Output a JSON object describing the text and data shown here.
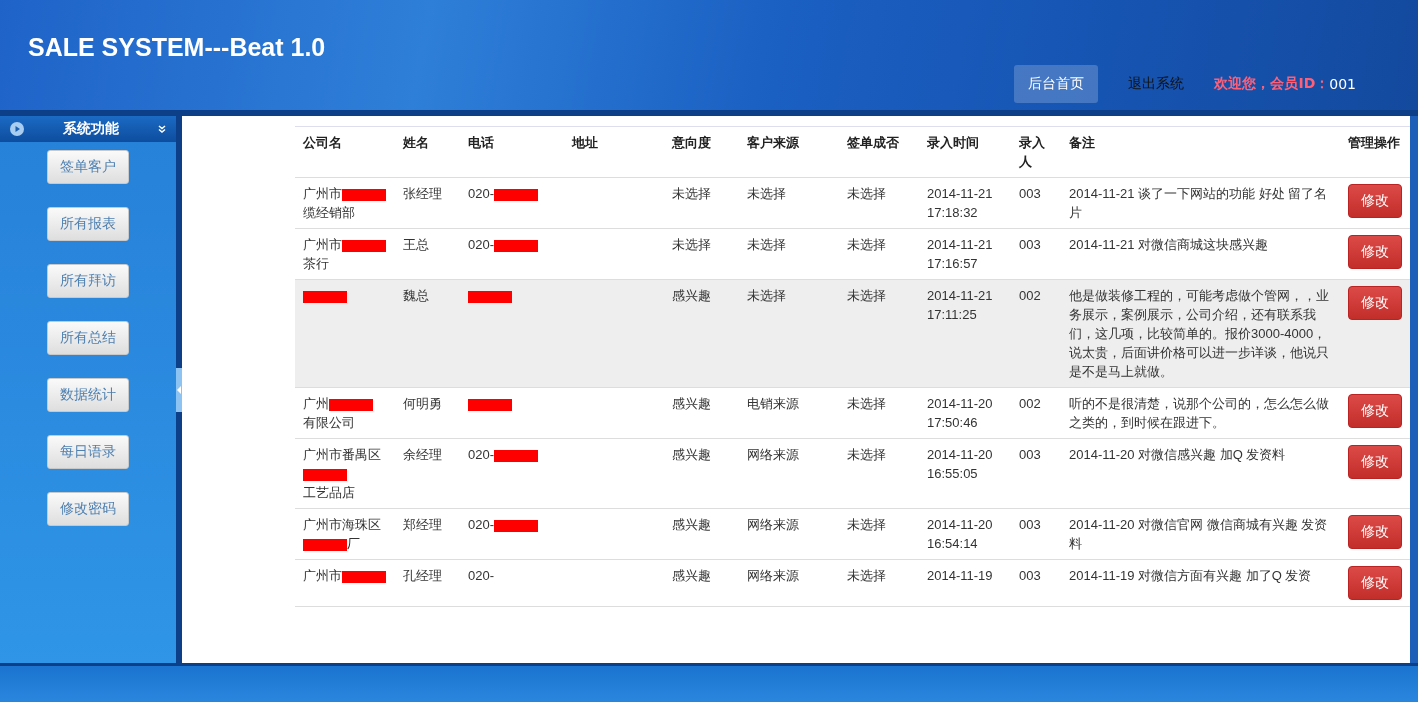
{
  "header": {
    "title": "SALE SYSTEM---Beat 1.0",
    "nav": [
      {
        "label": "后台首页",
        "selected": true
      },
      {
        "label": "退出系统",
        "selected": false
      }
    ],
    "welcome": "欢迎您，会员ID：",
    "member_id": "001"
  },
  "sidebar": {
    "title": "系统功能",
    "items": [
      "签单客户",
      "所有报表",
      "所有拜访",
      "所有总结",
      "数据统计",
      "每日语录",
      "修改密码"
    ]
  },
  "table": {
    "columns": [
      "公司名",
      "姓名",
      "电话",
      "地址",
      "意向度",
      "客户来源",
      "签单成否",
      "录入时间",
      "录入人",
      "备注",
      "管理操作"
    ],
    "rows": [
      {
        "highlighted": false,
        "company": [
          {
            "kind": "text",
            "text": "广州市"
          },
          {
            "kind": "redacted"
          },
          {
            "kind": "text",
            "text": "缆经销部"
          }
        ],
        "name": "张经理",
        "phone": [
          {
            "kind": "text",
            "text": "020-"
          },
          {
            "kind": "redacted"
          }
        ],
        "intent": "未选择",
        "source": "未选择",
        "signed": "未选择",
        "time": "2014-11-21 17:18:32",
        "entered_by": "003",
        "remark": "2014-11-21 谈了一下网站的功能 好处 留了名片",
        "action": "修改"
      },
      {
        "highlighted": false,
        "company": [
          {
            "kind": "text",
            "text": "广州市"
          },
          {
            "kind": "redacted"
          },
          {
            "kind": "text",
            "text": "茶行"
          }
        ],
        "name": "王总",
        "phone": [
          {
            "kind": "text",
            "text": "020-"
          },
          {
            "kind": "redacted"
          }
        ],
        "intent": "未选择",
        "source": "未选择",
        "signed": "未选择",
        "time": "2014-11-21 17:16:57",
        "entered_by": "003",
        "remark": "2014-11-21 对微信商城这块感兴趣",
        "action": "修改"
      },
      {
        "highlighted": true,
        "company": [
          {
            "kind": "redacted"
          }
        ],
        "name": "魏总",
        "phone": [
          {
            "kind": "redacted"
          }
        ],
        "intent": "感兴趣",
        "source": "未选择",
        "signed": "未选择",
        "time": "2014-11-21 17:11:25",
        "entered_by": "002",
        "remark": "他是做装修工程的，可能考虑做个管网，，业务展示，案例展示，公司介绍，还有联系我们，这几项，比较简单的。报价3000-4000，说太贵，后面讲价格可以进一步详谈，他说只是不是马上就做。",
        "action": "修改"
      },
      {
        "highlighted": false,
        "company": [
          {
            "kind": "text",
            "text": "广州"
          },
          {
            "kind": "redacted"
          },
          {
            "kind": "text",
            "text": "有限公司"
          }
        ],
        "name": "何明勇",
        "phone": [
          {
            "kind": "redacted"
          }
        ],
        "intent": "感兴趣",
        "source": "电销来源",
        "signed": "未选择",
        "time": "2014-11-20 17:50:46",
        "entered_by": "002",
        "remark": "听的不是很清楚，说那个公司的，怎么怎么做之类的，到时候在跟进下。",
        "action": "修改"
      },
      {
        "highlighted": false,
        "company": [
          {
            "kind": "text",
            "text": "广州市番禺区"
          },
          {
            "kind": "redacted"
          },
          {
            "kind": "text",
            "text": "工艺品店"
          }
        ],
        "name": "余经理",
        "phone": [
          {
            "kind": "text",
            "text": "020-"
          },
          {
            "kind": "redacted"
          }
        ],
        "intent": "感兴趣",
        "source": "网络来源",
        "signed": "未选择",
        "time": "2014-11-20 16:55:05",
        "entered_by": "003",
        "remark": "2014-11-20 对微信感兴趣 加Q 发资料",
        "action": "修改"
      },
      {
        "highlighted": false,
        "company": [
          {
            "kind": "text",
            "text": "广州市海珠区"
          },
          {
            "kind": "redacted"
          },
          {
            "kind": "text",
            "text": "厂"
          }
        ],
        "name": "郑经理",
        "phone": [
          {
            "kind": "text",
            "text": "020-"
          },
          {
            "kind": "redacted"
          }
        ],
        "intent": "感兴趣",
        "source": "网络来源",
        "signed": "未选择",
        "time": "2014-11-20 16:54:14",
        "entered_by": "003",
        "remark": "2014-11-20 对微信官网 微信商城有兴趣 发资料",
        "action": "修改"
      },
      {
        "highlighted": false,
        "company": [
          {
            "kind": "text",
            "text": "广州市"
          },
          {
            "kind": "redacted"
          }
        ],
        "name": "孔经理",
        "phone": [
          {
            "kind": "text",
            "text": "020-"
          }
        ],
        "intent": "感兴趣",
        "source": "网络来源",
        "signed": "未选择",
        "time": "2014-11-19",
        "entered_by": "003",
        "remark": "2014-11-19 对微信方面有兴趣 加了Q 发资",
        "action": "修改"
      }
    ]
  }
}
